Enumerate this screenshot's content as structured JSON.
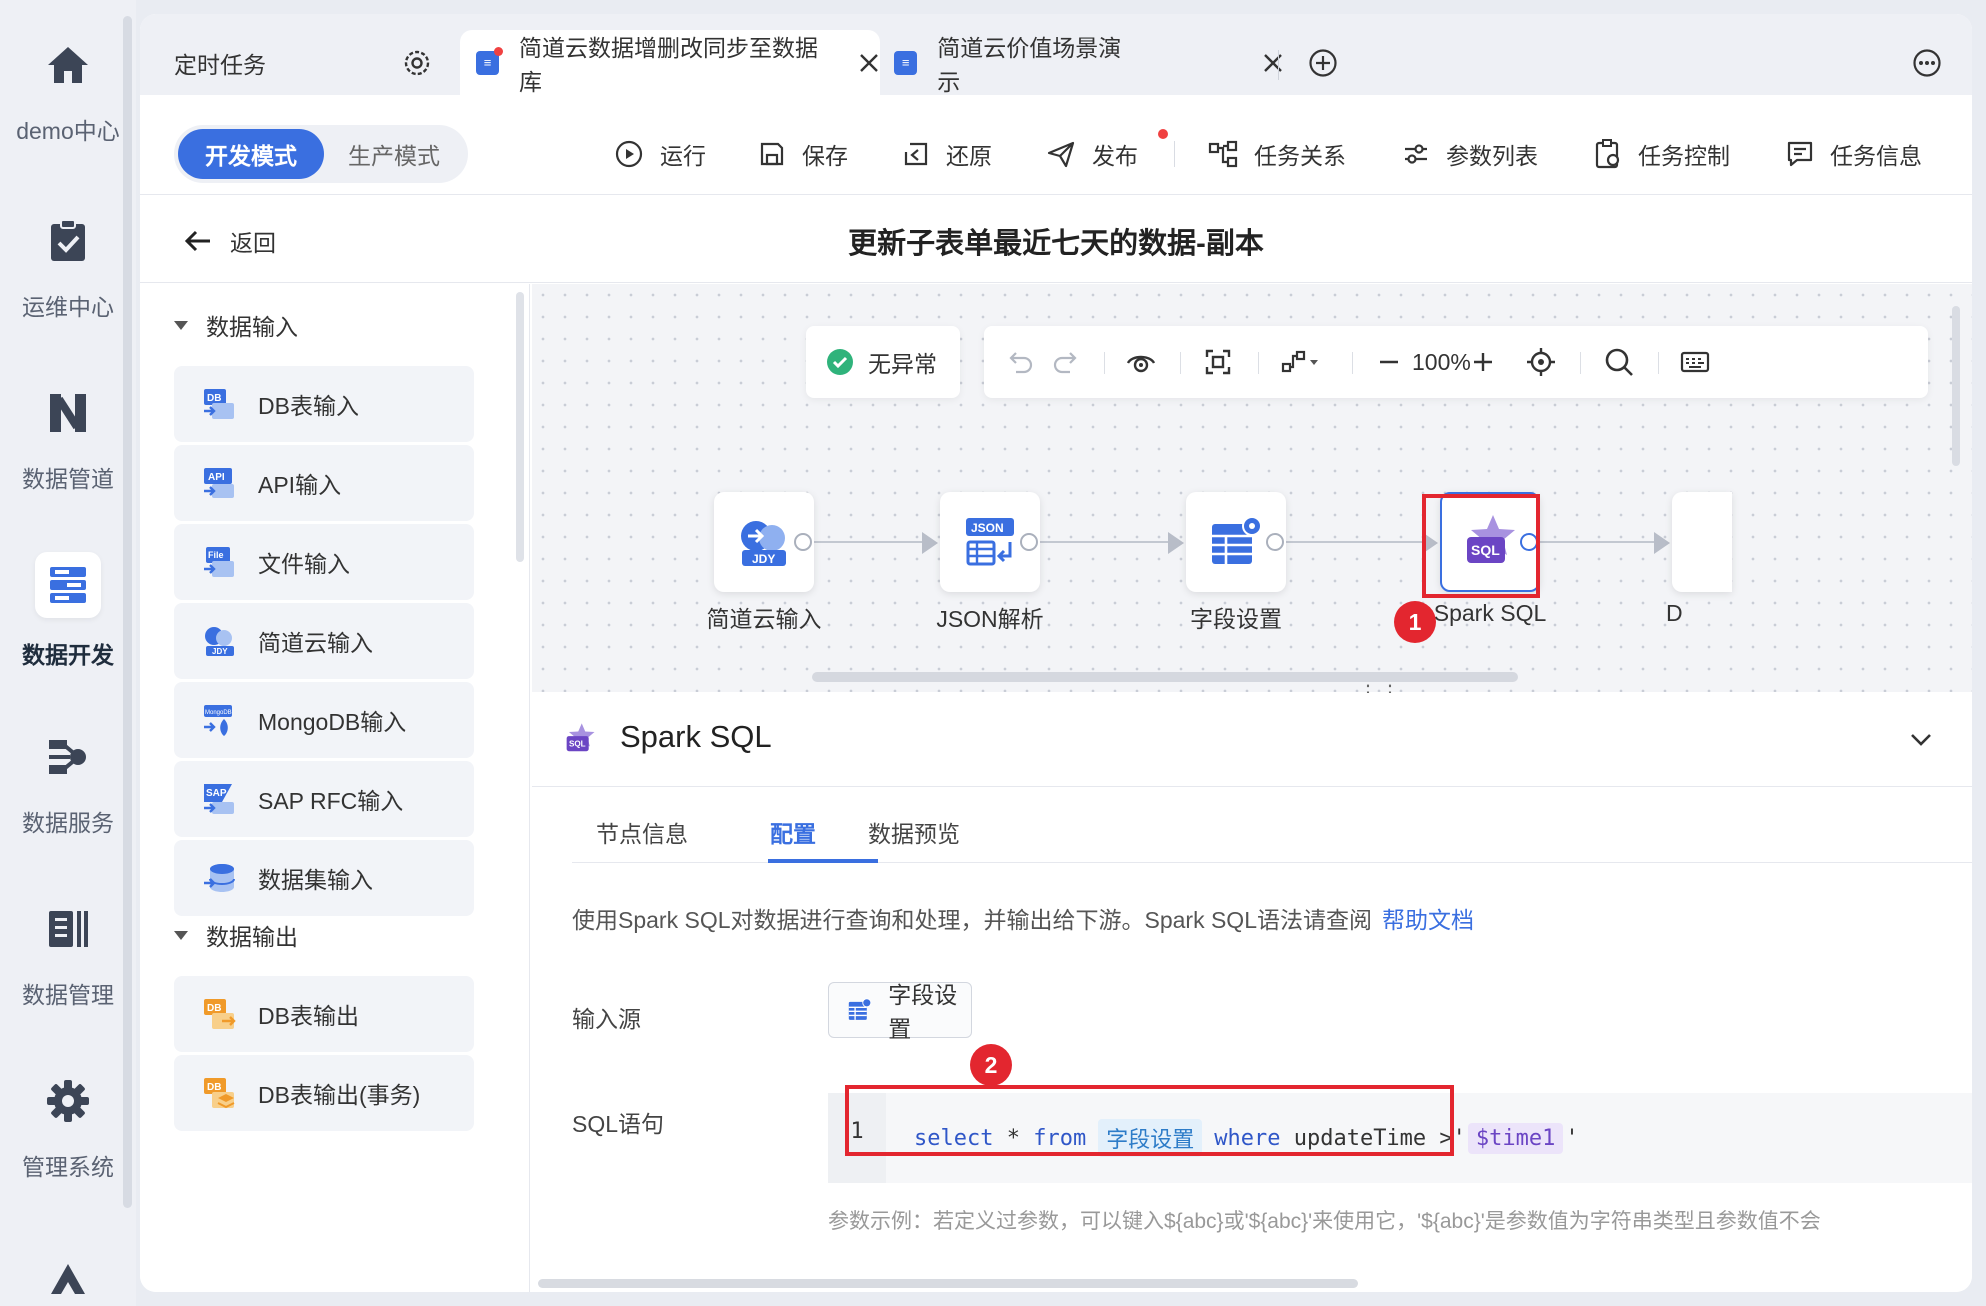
{
  "rail": {
    "items": [
      {
        "label": "demo中心",
        "icon": "home-icon"
      },
      {
        "label": "运维中心",
        "icon": "clipboard-check-icon"
      },
      {
        "label": "数据管道",
        "icon": "pipeline-icon"
      },
      {
        "label": "数据开发",
        "icon": "data-dev-icon",
        "active": true
      },
      {
        "label": "数据服务",
        "icon": "data-service-icon"
      },
      {
        "label": "数据管理",
        "icon": "data-manage-icon"
      },
      {
        "label": "管理系统",
        "icon": "gear-icon"
      }
    ]
  },
  "tabs": [
    {
      "label": "定时任务"
    },
    {
      "label": "简道云数据增删改同步至数据库",
      "active": true
    },
    {
      "label": "简道云价值场景演示"
    }
  ],
  "toolbar": {
    "modes": {
      "dev": "开发模式",
      "prod": "生产模式"
    },
    "run": "运行",
    "save": "保存",
    "restore": "还原",
    "publish": "发布",
    "task_relation": "任务关系",
    "param_list": "参数列表",
    "task_control": "任务控制",
    "task_info": "任务信息"
  },
  "titlebar": {
    "back": "返回",
    "title": "更新子表单最近七天的数据-副本"
  },
  "components": {
    "input_group": "数据输入",
    "inputs": [
      "DB表输入",
      "API输入",
      "文件输入",
      "简道云输入",
      "MongoDB输入",
      "SAP RFC输入",
      "数据集输入"
    ],
    "output_group": "数据输出",
    "outputs": [
      "DB表输出",
      "DB表输出(事务)"
    ],
    "icon_texts": {
      "db": "DB",
      "api": "API",
      "file": "File",
      "jdy": "JDY",
      "mongo": "MongoDB",
      "sap": "SAP"
    }
  },
  "canvas": {
    "status": "无异常",
    "zoom": "100%",
    "nodes": [
      {
        "label": "简道云输入",
        "icon_text": "JDY"
      },
      {
        "label": "JSON解析",
        "icon_text": "JSON"
      },
      {
        "label": "字段设置"
      },
      {
        "label": "Spark SQL",
        "icon_text": "SQL",
        "selected": true
      },
      {
        "label": "D"
      }
    ],
    "annotation_1": "1",
    "annotation_2": "2"
  },
  "config": {
    "title": "Spark SQL",
    "tabs": [
      "节点信息",
      "配置",
      "数据预览"
    ],
    "active_tab": "配置",
    "description": "使用Spark SQL对数据进行查询和处理，并输出给下游。Spark SQL语法请查阅",
    "help_link": "帮助文档",
    "source_label": "输入源",
    "source_value": "字段设置",
    "sql_label": "SQL语句",
    "line_number": "1",
    "sql": {
      "select": "select",
      "star": "*",
      "from": "from",
      "table": "字段设置",
      "where": "where",
      "column": "updateTime",
      "op": ">'",
      "param": "$time1",
      "close": "'"
    },
    "hint": "参数示例：若定义过参数，可以键入${abc}或'${abc}'来使用它，'${abc}'是参数值为字符串类型且参数值不会"
  },
  "colors": {
    "accent": "#3a6fe0",
    "highlight": "#e3262f",
    "sql_purple": "#6b45c4"
  }
}
